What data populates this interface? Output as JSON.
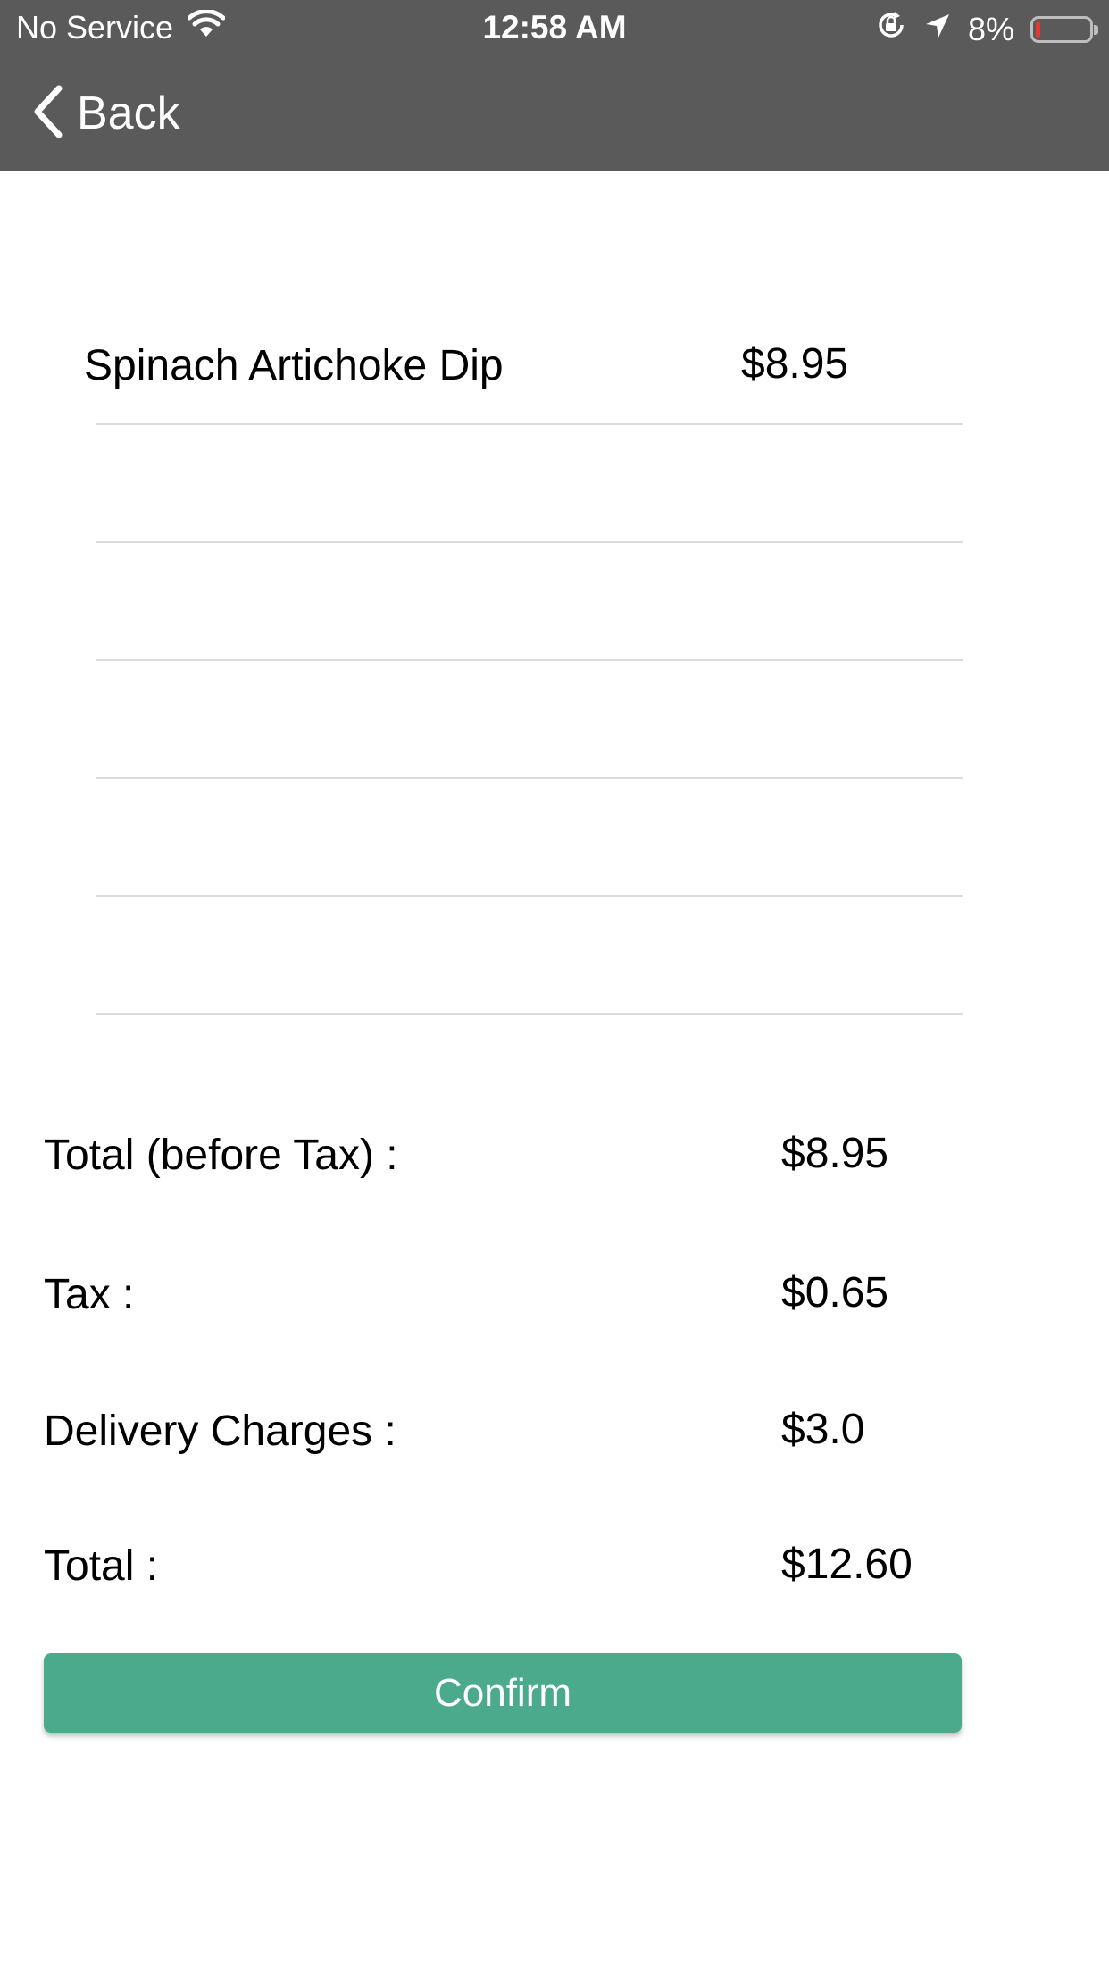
{
  "status_bar": {
    "carrier": "No Service",
    "time": "12:58 AM",
    "battery_percent": "8%",
    "battery_level": 0.08,
    "battery_color": "#e53935",
    "icons": [
      "wifi-icon",
      "orientation-lock-icon",
      "location-arrow-icon",
      "battery-icon"
    ]
  },
  "nav": {
    "back_label": "Back",
    "back_icon": "chevron-left-icon",
    "bar_color": "#5a5a5a"
  },
  "order": {
    "items": [
      {
        "name": "Spinach Artichoke Dip",
        "price": "$8.95"
      },
      {
        "name": "",
        "price": ""
      },
      {
        "name": "",
        "price": ""
      },
      {
        "name": "",
        "price": ""
      },
      {
        "name": "",
        "price": ""
      },
      {
        "name": "",
        "price": ""
      }
    ]
  },
  "summary": {
    "subtotal_label": "Total (before Tax) :",
    "subtotal_value": "$8.95",
    "tax_label": "Tax :",
    "tax_value": "$0.65",
    "delivery_label": "Delivery Charges :",
    "delivery_value": "$3.0",
    "total_label": "Total :",
    "total_value": "$12.60"
  },
  "confirm": {
    "label": "Confirm",
    "color": "#4caa8c"
  }
}
